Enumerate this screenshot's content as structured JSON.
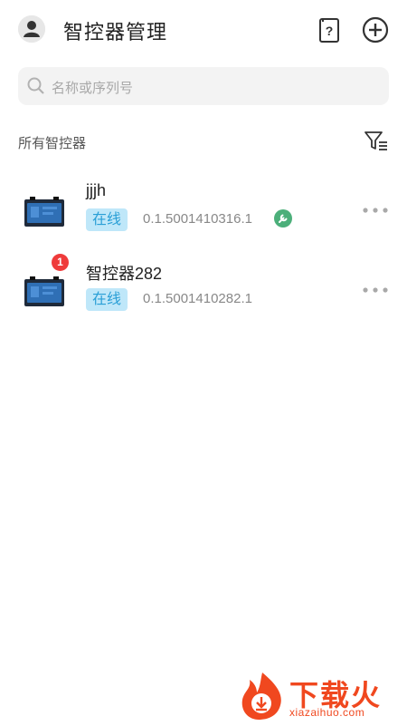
{
  "header": {
    "title": "智控器管理",
    "avatar_icon": "user-avatar-icon",
    "help_icon": "help-icon",
    "add_icon": "add-circle-icon"
  },
  "search": {
    "placeholder": "名称或序列号",
    "icon": "search-icon"
  },
  "section": {
    "label": "所有智控器",
    "filter_icon": "filter-list-icon"
  },
  "devices": [
    {
      "name": "jjjh",
      "status": "在线",
      "serial": "0.1.5001410316.1",
      "has_wrench": true,
      "badge": null
    },
    {
      "name": "智控器282",
      "status": "在线",
      "serial": "0.1.5001410282.1",
      "has_wrench": false,
      "badge": "1"
    }
  ],
  "watermark": {
    "text": "下载火",
    "sub": "xiazaihuo.com"
  },
  "colors": {
    "status_bg": "#bfe7f9",
    "status_text": "#2a9fd6",
    "badge": "#ef3b3b",
    "wrench": "#4caf7a",
    "brand": "#f0481f"
  }
}
